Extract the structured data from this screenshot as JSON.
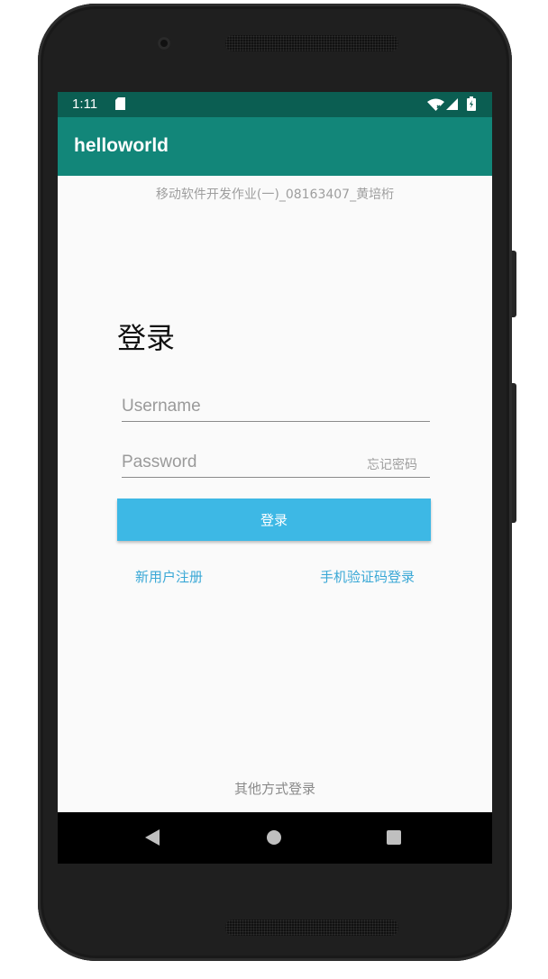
{
  "status_bar": {
    "time": "1:11",
    "icons": [
      "sd-card-icon",
      "wifi-icon",
      "signal-icon",
      "battery-icon"
    ]
  },
  "app_bar": {
    "title": "helloworld"
  },
  "subtitle": "移动软件开发作业(一)_08163407_黄培桁",
  "login": {
    "title": "登录",
    "username_placeholder": "Username",
    "username_value": "",
    "password_placeholder": "Password",
    "password_value": "",
    "forgot_password": "忘记密码",
    "login_button": "登录",
    "register_link": "新用户注册",
    "sms_login_link": "手机验证码登录"
  },
  "footer": {
    "other_login": "其他方式登录"
  },
  "nav_bar": {
    "icons": [
      "back-icon",
      "home-icon",
      "recents-icon"
    ]
  },
  "colors": {
    "status_bar": "#0b5e52",
    "app_bar": "#128679",
    "accent_button": "#3db8e5",
    "link": "#3aa8d6"
  }
}
